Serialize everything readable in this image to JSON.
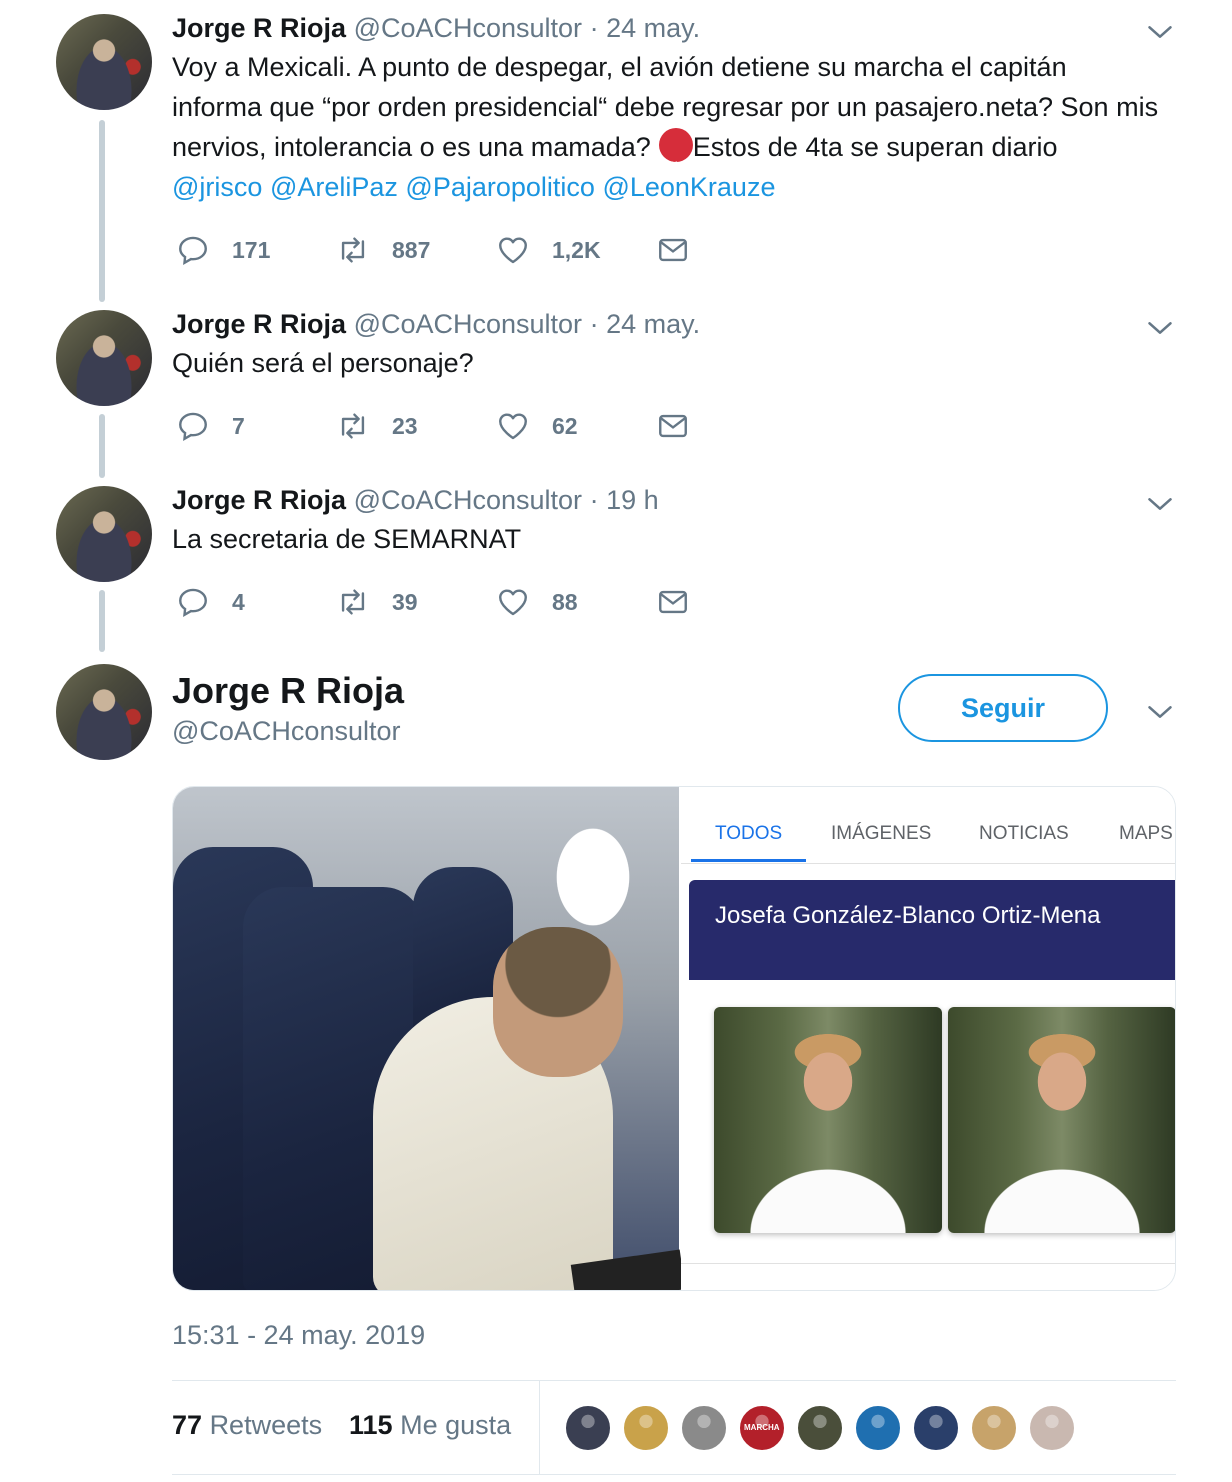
{
  "tweets": [
    {
      "name": "Jorge R Rioja",
      "handle": "@CoACHconsultor",
      "dot": "·",
      "time": "24 may.",
      "text_before_emoji": "Voy a Mexicali. A punto de despegar, el avión detiene su marcha el capitán informa que “por orden presidencial“ debe regresar por un pasajero.neta? Son mis nervios, intolerancia o es una mamada?",
      "text_after_emoji": "Estos de 4ta se superan diario",
      "mentions": [
        "@jrisco",
        "@AreliPaz",
        "@Pajaropolitico",
        "@LeonKrauze"
      ],
      "replies": "171",
      "retweets": "887",
      "likes": "1,2K"
    },
    {
      "name": "Jorge R Rioja",
      "handle": "@CoACHconsultor",
      "dot": "·",
      "time": "24 may.",
      "text": "Quién será el personaje?",
      "replies": "7",
      "retweets": "23",
      "likes": "62"
    },
    {
      "name": "Jorge R Rioja",
      "handle": "@CoACHconsultor",
      "dot": "·",
      "time": "19 h",
      "text": "La secretaria de SEMARNAT",
      "replies": "4",
      "retweets": "39",
      "likes": "88"
    }
  ],
  "main": {
    "name": "Jorge R Rioja",
    "handle": "@CoACHconsultor",
    "follow_label": "Seguir",
    "media": {
      "search_tabs": [
        "TODOS",
        "IMÁGENES",
        "NOTICIAS",
        "MAPS"
      ],
      "active_tab": "TODOS",
      "result_title": "Josefa González-Blanco Ortiz-Mena"
    },
    "timestamp": "15:31 - 24 may. 2019",
    "retweet_count": "77",
    "retweet_label": "Retweets",
    "like_count": "115",
    "like_label": "Me gusta",
    "liker_colors": [
      "#3a3f52",
      "#c9a24a",
      "#8a8a8a",
      "#b3202a",
      "#4a4e3a",
      "#1f6fb0",
      "#2a3f6a",
      "#c7a36a",
      "#c9b8b0"
    ],
    "liker_badge": "MARCHA"
  },
  "colors": {
    "accent": "#1b95e0",
    "secondary_text": "#657786",
    "thread_line": "#c4cfd6",
    "google_card": "#272a6b"
  }
}
